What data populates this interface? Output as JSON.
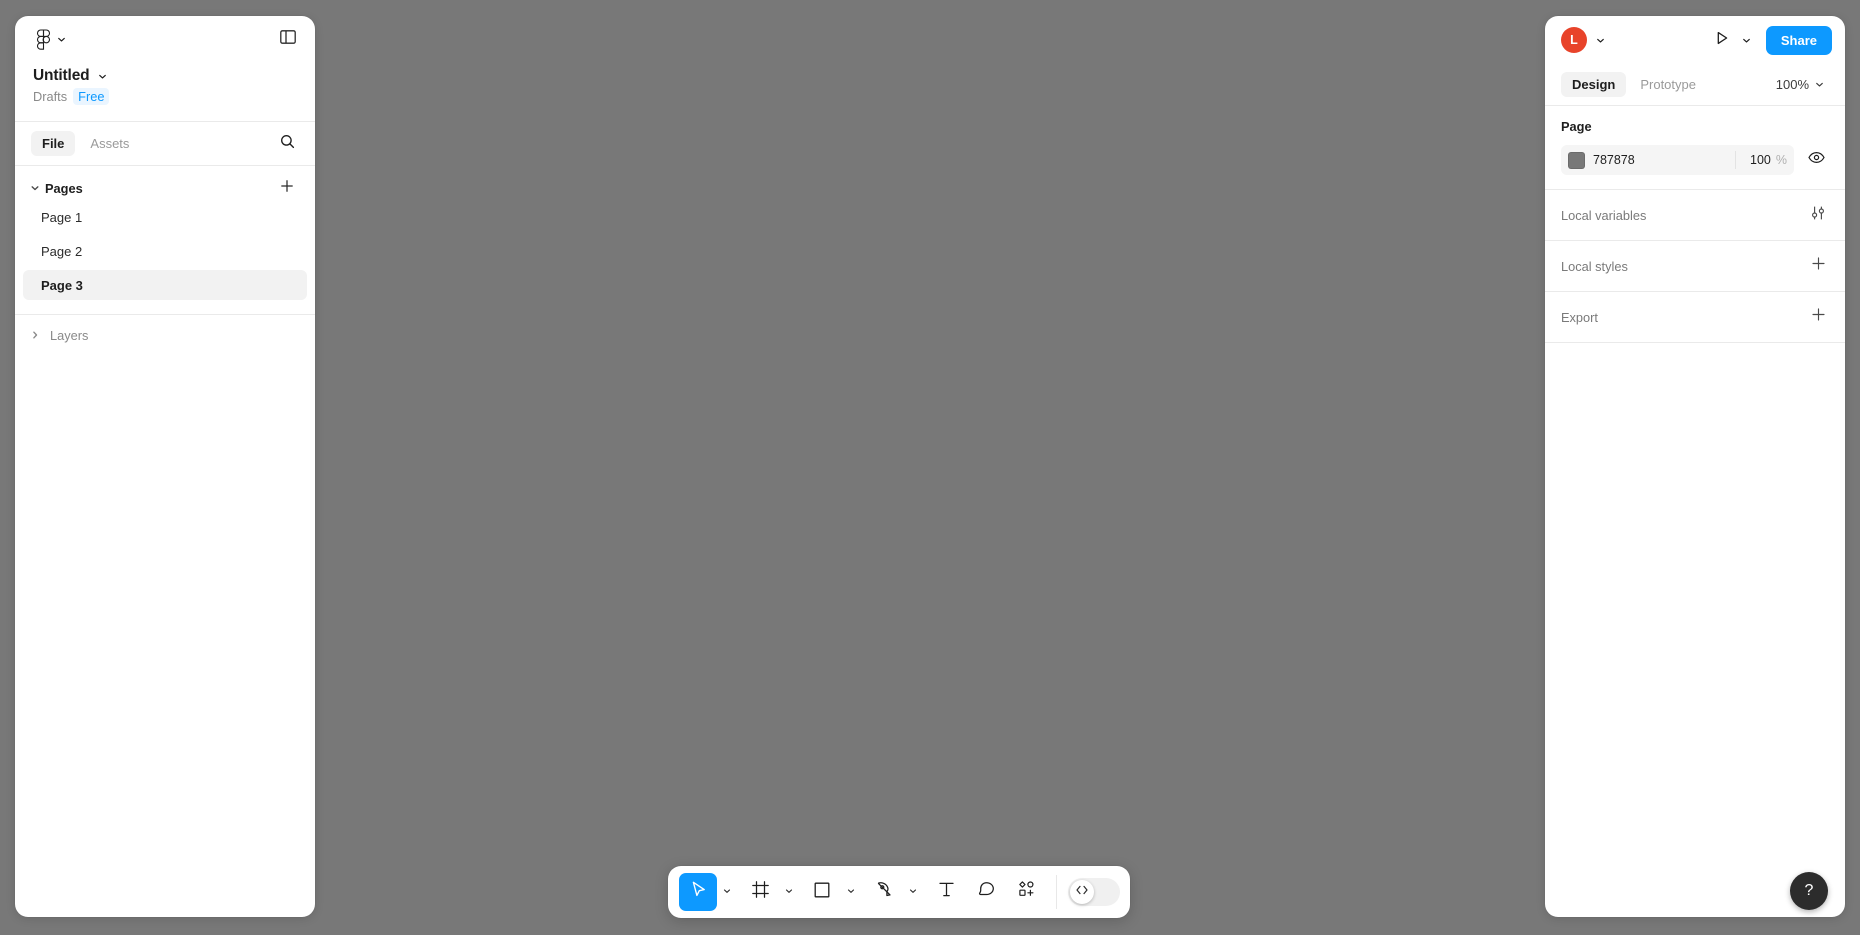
{
  "canvas": {
    "background_color": "#787878"
  },
  "left_panel": {
    "logo_icon": "figma-logo-icon",
    "logo_chevron_icon": "chevron-down-icon",
    "panel_toggle_icon": "panel-layout-icon",
    "file_title": "Untitled",
    "file_title_chevron_icon": "chevron-down-icon",
    "location": "Drafts",
    "plan_badge": "Free",
    "plan_badge_color": "#0d99ff",
    "tabs": [
      {
        "label": "File",
        "active": true
      },
      {
        "label": "Assets",
        "active": false
      }
    ],
    "search_icon": "search-icon",
    "pages": {
      "caret_icon": "caret-down-icon",
      "label": "Pages",
      "add_icon": "plus-icon",
      "items": [
        {
          "label": "Page 1",
          "selected": false
        },
        {
          "label": "Page 2",
          "selected": false
        },
        {
          "label": "Page 3",
          "selected": true
        }
      ]
    },
    "layers": {
      "caret_icon": "caret-right-icon",
      "label": "Layers"
    }
  },
  "right_panel": {
    "avatar_initial": "L",
    "avatar_color": "#e8432a",
    "avatar_chevron_icon": "chevron-down-icon",
    "present_icon": "play-icon",
    "present_chevron_icon": "chevron-down-icon",
    "share_label": "Share",
    "share_color": "#0d99ff",
    "tabs": [
      {
        "label": "Design",
        "active": true
      },
      {
        "label": "Prototype",
        "active": false
      }
    ],
    "zoom_level": "100%",
    "zoom_chevron_icon": "chevron-down-icon",
    "page_section": {
      "title": "Page",
      "fill_hex": "787878",
      "fill_swatch_color": "#787878",
      "opacity": "100",
      "opacity_unit": "%",
      "visibility_icon": "eye-icon"
    },
    "rows": [
      {
        "label": "Local variables",
        "icon": "sliders-icon"
      },
      {
        "label": "Local styles",
        "icon": "plus-icon"
      },
      {
        "label": "Export",
        "icon": "plus-icon"
      }
    ]
  },
  "toolbar": {
    "tools": [
      {
        "name": "move-tool",
        "icon": "cursor-arrow-icon",
        "active": true,
        "has_chevron": true
      },
      {
        "name": "frame-tool",
        "icon": "frame-icon",
        "active": false,
        "has_chevron": true
      },
      {
        "name": "shape-tool",
        "icon": "square-icon",
        "active": false,
        "has_chevron": true
      },
      {
        "name": "pen-tool",
        "icon": "pen-icon",
        "active": false,
        "has_chevron": true
      },
      {
        "name": "text-tool",
        "icon": "text-icon",
        "active": false,
        "has_chevron": false
      },
      {
        "name": "comment-tool",
        "icon": "comment-icon",
        "active": false,
        "has_chevron": false
      },
      {
        "name": "actions-tool",
        "icon": "resources-icon",
        "active": false,
        "has_chevron": false
      }
    ],
    "code_toggle": {
      "icon": "code-icon",
      "enabled": false
    }
  },
  "help_button": {
    "label": "?",
    "icon": "question-mark-icon"
  }
}
